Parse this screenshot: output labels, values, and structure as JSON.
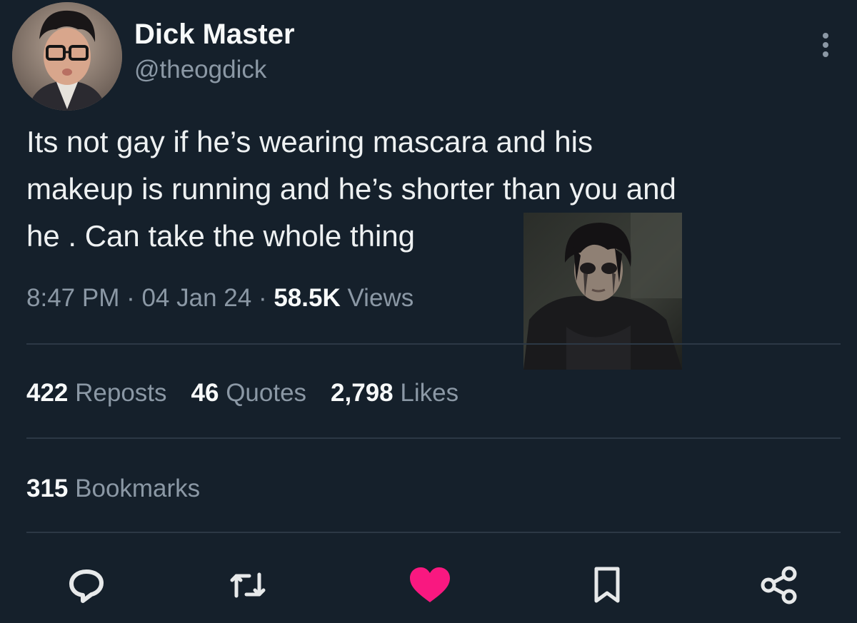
{
  "user": {
    "display_name": "Dick Master",
    "handle": "@theogdick"
  },
  "tweet": {
    "text_lines": [
      "Its not gay if he’s wearing mascara and his",
      "makeup is running and he’s shorter than you and",
      "he . Can take the whole thing"
    ]
  },
  "meta": {
    "time": "8:47 PM",
    "sep1": " · ",
    "date": "04 Jan 24",
    "sep2": " · ",
    "views_count": "58.5K",
    "views_label": " Views"
  },
  "stats": {
    "reposts_count": "422",
    "reposts_label": " Reposts",
    "quotes_count": "46",
    "quotes_label": " Quotes",
    "likes_count": "2,798",
    "likes_label": " Likes",
    "bookmarks_count": "315",
    "bookmarks_label": " Bookmarks"
  },
  "actions": {
    "reply_icon": "reply-icon",
    "retweet_icon": "retweet-icon",
    "like_icon": "heart-icon",
    "bookmark_icon": "bookmark-icon",
    "share_icon": "share-icon"
  },
  "colors": {
    "background": "#15202b",
    "text_primary": "#e7e9ea",
    "text_secondary": "#8b98a5",
    "like_active": "#f91880",
    "divider": "#2c3845"
  }
}
